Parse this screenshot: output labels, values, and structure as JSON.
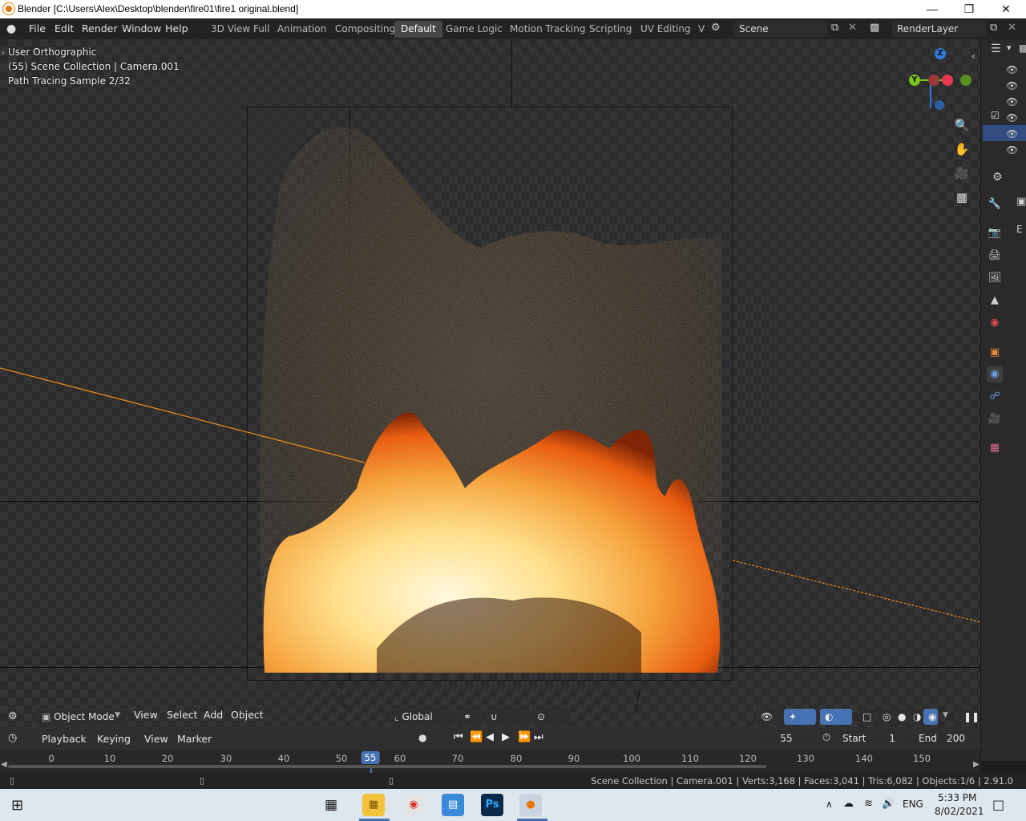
{
  "os_title": "Blender [C:\\Users\\Alex\\Desktop\\blender\\fire01\\fire1 original.blend]",
  "menus": [
    "File",
    "Edit",
    "Render",
    "Window",
    "Help"
  ],
  "workspaces": [
    "3D View Full",
    "Animation",
    "Compositing",
    "Default",
    "Game Logic",
    "Motion Tracking",
    "Scripting",
    "UV Editing",
    "V"
  ],
  "active_workspace": "Default",
  "scene_name": "Scene",
  "render_layer": "RenderLayer",
  "viewport": {
    "view_name": "User Orthographic",
    "collection_info": "(55) Scene Collection | Camera.001",
    "render_status": "Path Tracing Sample 2/32"
  },
  "gizmo": {
    "z": "Z",
    "y": "Y"
  },
  "header": {
    "mode": "Object Mode",
    "menus": [
      "View",
      "Select",
      "Add",
      "Object"
    ],
    "orientation": "Global"
  },
  "timeline": {
    "menus": [
      "Playback",
      "Keying",
      "View",
      "Marker"
    ],
    "current_frame": "55",
    "start_label": "Start",
    "start_value": "1",
    "end_label": "End",
    "end_value": "200",
    "ticks": [
      "0",
      "10",
      "20",
      "30",
      "40",
      "50",
      "55",
      "60",
      "70",
      "80",
      "90",
      "100",
      "110",
      "120",
      "130",
      "140",
      "150"
    ]
  },
  "status": "Scene Collection | Camera.001 | Verts:3,168 | Faces:3,041 | Tris:6,082 | Objects:1/6 | 2.91.0",
  "taskbar": {
    "language": "ENG",
    "time": "5:33 PM",
    "date": "8/02/2021",
    "ps_label": "Ps"
  },
  "side_tab_label": "E",
  "colors": {
    "accent": "#4772b3",
    "fire_core": "#fff2b0",
    "fire_edge": "#e8590c",
    "camera_line": "#e68a1a",
    "gizmo_z": "#2f7bdc",
    "gizmo_y": "#7dc31d",
    "gizmo_x": "#e8384f"
  }
}
